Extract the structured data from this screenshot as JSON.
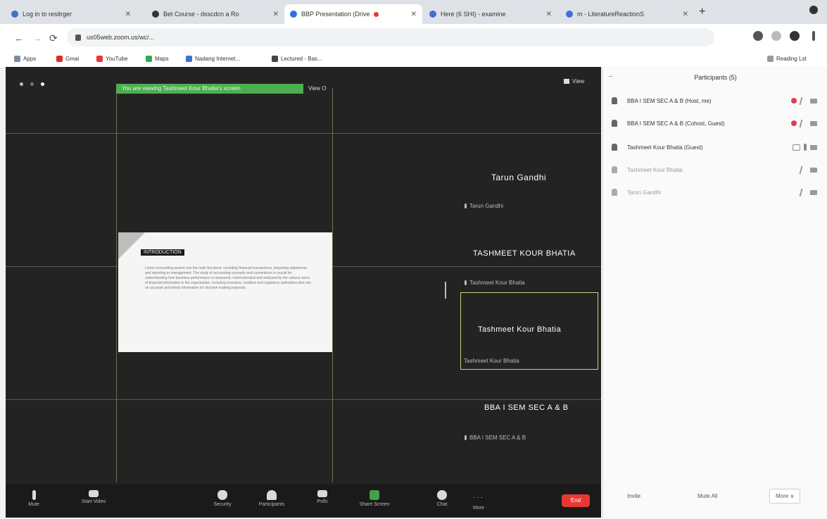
{
  "browser": {
    "tabs": [
      {
        "label": "Log in to resitrger",
        "icon_color": "#3f6fd1",
        "active": false
      },
      {
        "label": "Bet Course - dsscdcn a Ro",
        "icon_color": "#333333",
        "active": false
      },
      {
        "label": "BBP Presentation (Drive",
        "icon_color": "#2f6fe0",
        "active": true
      },
      {
        "label": "Here (6 SHI) - examine",
        "icon_color": "#3f6fd1",
        "active": false
      },
      {
        "label": "m - LiteratureReactionS",
        "icon_color": "#3f6fd1",
        "active": false
      }
    ],
    "new_tab_label": "+",
    "url": "us05web.zoom.us/wc/...",
    "bookmarks": [
      {
        "label": "Apps",
        "icon_color": "#7a8ca8"
      },
      {
        "label": "Gmai",
        "icon_color": "#d93025"
      },
      {
        "label": "YouTube",
        "icon_color": "#e53935"
      },
      {
        "label": "Maps",
        "icon_color": "#34a853"
      },
      {
        "label": "Nadang Internet...",
        "icon_color": "#3f6fd1"
      },
      {
        "label": "Lectured - Bas...",
        "icon_color": "#444444"
      }
    ],
    "reading_list": "Reading Lst"
  },
  "meeting": {
    "banner_text": "You are viewing Tashmeet Kour Bhatia's screen",
    "banner_side": "Viеw O",
    "view_button": "View",
    "slide": {
      "title": "INTRODUCTION",
      "body": "Lorem accounting system has the main functions: recording financial transactions, preparing statements and reporting to management. The study of accounting concepts and conventions is crucial for understanding how business performance is measured, communicated and analysed by the various users of financial information in the organisation, including investors, creditors and regulatory authorities who rely on accurate and timely information for decision making purposes."
    },
    "participants_tiles": [
      {
        "big": "Tarun Gandhi",
        "small": "Tarun Gandhi"
      },
      {
        "big": "TASHMEET KOUR BHATIA",
        "small": "Tashmeet Kour Bhatia"
      },
      {
        "big": "Tashmeet Kour Bhatia",
        "small": "Tashmeet Kour Bhatia"
      },
      {
        "big": "BBA I SEM SEC A & B",
        "small": "BBA I SEM SEC A & B"
      }
    ],
    "toolbar": {
      "mute": "Mute",
      "start_video": "Start Video",
      "security": "Security",
      "participants": "Participants",
      "polls": "Polls",
      "share": "Share Screen",
      "chat": "Chat",
      "more": "More",
      "end": "End"
    }
  },
  "panel": {
    "title": "Participants (5)",
    "participants": [
      {
        "name": "BBA I SEM SEC A & B (Host, me)",
        "indicators": [
          "rec",
          "micmute",
          "cam"
        ]
      },
      {
        "name": "BBA I SEM SEC A & B (Cohost, Guest)",
        "indicators": [
          "rec",
          "micmute",
          "cam"
        ]
      },
      {
        "name": "Tashmeet Kour Bhatia (Guest)",
        "indicators": [
          "share",
          "mic",
          "cam"
        ]
      },
      {
        "name": "Tashmeet Kour Bhatia",
        "indicators": [
          "micmute",
          "cam"
        ]
      },
      {
        "name": "Tarun Gandhi",
        "indicators": [
          "micmute",
          "cam"
        ]
      }
    ],
    "footer": {
      "invite": "Invite",
      "mute_all": "Mute All",
      "more": "More ∨"
    }
  }
}
